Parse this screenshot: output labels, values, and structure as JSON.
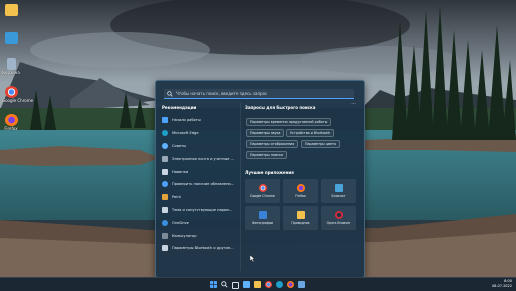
{
  "desktop": {
    "icons": [
      {
        "label": "",
        "icon": "folder-icon",
        "color": "#f2c14e"
      },
      {
        "label": "",
        "icon": "this-pc-icon",
        "color": "#3a9ad9"
      },
      {
        "label": "Корзина",
        "icon": "recycle-bin-icon",
        "color": "#9fb4c8"
      },
      {
        "label": "Google Chrome",
        "icon": "chrome-icon",
        "color": "#e34133"
      },
      {
        "label": "Firefox",
        "icon": "firefox-icon",
        "color": "#ff7a1a"
      }
    ]
  },
  "search_panel": {
    "placeholder": "Чтобы начать поиск, введите здесь запрос",
    "recommended_title": "Рекомендации",
    "recommended": [
      {
        "label": "Начало работы",
        "icon": "getting-started-icon",
        "color": "#4da3ff"
      },
      {
        "label": "Microsoft Edge",
        "icon": "edge-icon",
        "color": "#1fa0c9"
      },
      {
        "label": "Советы",
        "icon": "tips-icon",
        "color": "#5fb3ff"
      },
      {
        "label": "Электронная почта и учетные ...",
        "icon": "mail-icon",
        "color": "#9aa9b8"
      },
      {
        "label": "Новинки",
        "icon": "news-icon",
        "color": "#c8d4df"
      },
      {
        "label": "Проверить наличие обновлени...",
        "icon": "update-icon",
        "color": "#4da3ff"
      },
      {
        "label": "Paint",
        "icon": "paint-icon",
        "color": "#e2a33c"
      },
      {
        "label": "Тема и сопутствующие парам...",
        "icon": "theme-icon",
        "color": "#c8d4df"
      },
      {
        "label": "OneDrive",
        "icon": "onedrive-icon",
        "color": "#3a8fe0"
      },
      {
        "label": "Калькулятор",
        "icon": "calculator-icon",
        "color": "#7d8b99"
      },
      {
        "label": "Параметры Bluetooth и другие...",
        "icon": "bluetooth-icon",
        "color": "#c8d4df"
      }
    ],
    "quick_title": "Запросы для быстрого поиска",
    "quick": [
      "Параметры временно продуктивной работы",
      "Параметры звука",
      "Устройства и Bluetooth",
      "Параметры отображения",
      "Параметры цвета",
      "Параметры поиска"
    ],
    "top_apps_title": "Лучшие приложения",
    "top_apps": [
      {
        "label": "Google Chrome",
        "icon": "chrome-icon",
        "color": "#e34133"
      },
      {
        "label": "Firefox",
        "icon": "firefox-icon",
        "color": "#ff7a1a"
      },
      {
        "label": "Блокнот",
        "icon": "notepad-icon",
        "color": "#4aa3d8"
      },
      {
        "label": "Фотографии",
        "icon": "photos-icon",
        "color": "#3b82d6"
      },
      {
        "label": "Проводник",
        "icon": "explorer-icon",
        "color": "#f2c14e"
      },
      {
        "label": "Opera Browser",
        "icon": "opera-icon",
        "color": "#d42a3a"
      }
    ],
    "more_icon": "more-icon"
  },
  "taskbar": {
    "time": "8:00",
    "date": "08.07.2022",
    "icons": [
      {
        "icon": "start-icon",
        "color": "#4da3ff"
      },
      {
        "icon": "search-icon",
        "color": "#d5e2ec"
      },
      {
        "icon": "task-view-icon",
        "color": "#d5e2ec"
      },
      {
        "icon": "widgets-icon",
        "color": "#5fb3ff"
      },
      {
        "icon": "explorer-icon",
        "color": "#f2c14e"
      },
      {
        "icon": "chrome-icon",
        "color": "#e34133"
      },
      {
        "icon": "edge-icon",
        "color": "#1fa0c9"
      },
      {
        "icon": "firefox-icon",
        "color": "#ff7a1a"
      },
      {
        "icon": "store-icon",
        "color": "#6aa7e0"
      }
    ]
  }
}
